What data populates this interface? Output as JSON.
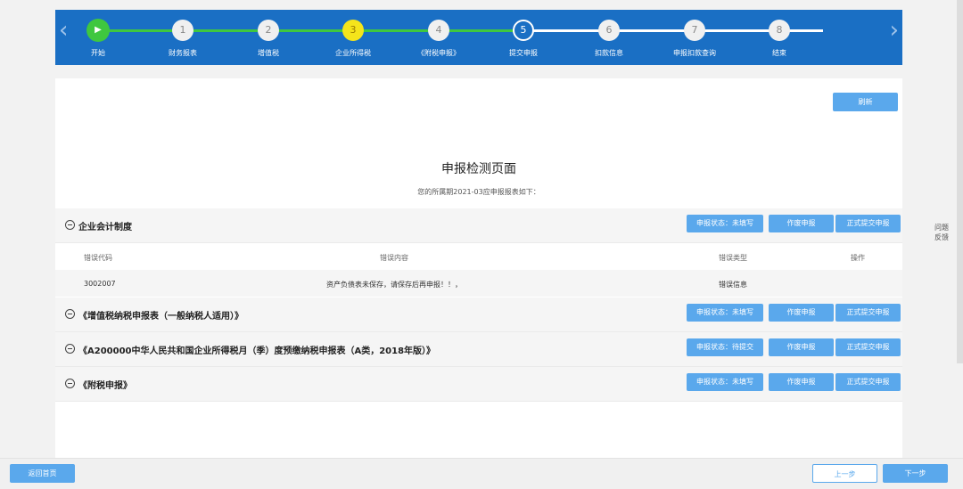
{
  "steps": [
    {
      "num": "▶",
      "label": "开始"
    },
    {
      "num": "1",
      "label": "财务报表"
    },
    {
      "num": "2",
      "label": "增值税"
    },
    {
      "num": "3",
      "label": "企业所得税"
    },
    {
      "num": "4",
      "label": "《附税申报》"
    },
    {
      "num": "5",
      "label": "提交申报"
    },
    {
      "num": "6",
      "label": "扣款信息"
    },
    {
      "num": "7",
      "label": "申报扣款查询"
    },
    {
      "num": "8",
      "label": "结束"
    }
  ],
  "nav": {
    "prev": "‹",
    "next": "›"
  },
  "main": {
    "refresh_label": "刷新",
    "title": "申报检测页面",
    "subtitle": "您的所属期2021-03应申报报表如下："
  },
  "sections": [
    {
      "title": "企业会计制度",
      "status": "申报状态：未填写",
      "void": "作废申报",
      "submit": "正式提交申报"
    },
    {
      "title": "《增值税纳税申报表（一般纳税人适用）》",
      "status": "申报状态：未填写",
      "void": "作废申报",
      "submit": "正式提交申报"
    },
    {
      "title": "《A200000中华人民共和国企业所得税月（季）度预缴纳税申报表（A类，2018年版）》",
      "status": "申报状态：待提交",
      "void": "作废申报",
      "submit": "正式提交申报"
    },
    {
      "title": "《附税申报》",
      "status": "申报状态：未填写",
      "void": "作废申报",
      "submit": "正式提交申报"
    }
  ],
  "error_table": {
    "headers": [
      "错误代码",
      "错误内容",
      "错误类型",
      "操作"
    ],
    "rows": [
      [
        "3002007",
        "资产负债表未保存，请保存后再申报！！，",
        "错误信息",
        ""
      ]
    ]
  },
  "side": {
    "feedback": "问题反馈"
  },
  "footer": {
    "back_home": "返回首页",
    "prev_step": "上一步",
    "next_step": "下一步"
  },
  "colors": {
    "step_bar": "#1a6fc4",
    "progress_done": "#3fc73f",
    "current_step": "#f5e41b",
    "button": "#5aa8ec"
  }
}
